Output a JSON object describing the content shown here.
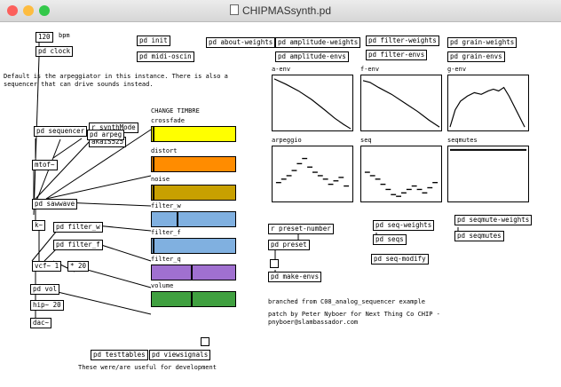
{
  "window": {
    "title": "CHIPMASsynth.pd",
    "traffic_light_colors": {
      "close": "#fc605c",
      "minimize": "#fdbc40",
      "zoom": "#34c84a"
    }
  },
  "objects": {
    "bpm_value": "120",
    "bpm_label": "bpm",
    "pd_clock": "pd clock",
    "pd_init": "pd init",
    "pd_midi_oscin": "pd midi-oscin",
    "pd_about_weights": "pd about-weights",
    "pd_amplitude_weights": "pd amplitude-weights",
    "pd_amplitude_envs": "pd amplitude-envs",
    "pd_filter_weights": "pd filter-weights",
    "pd_filter_envs": "pd filter-envs",
    "pd_grain_weights": "pd grain-weights",
    "pd_grain_envs": "pd grain-envs",
    "r_synthmode": "r synthMode",
    "akai_s525": "akaiS525",
    "pd_sequencer": "pd sequencer",
    "pd_arpeg": "pd arpeg",
    "mtof": "mtof~",
    "pd_sawwave": "pd sawwave",
    "k_obj": "k~",
    "pd_filter_w": "pd filter_w",
    "pd_filter_f": "pd filter_f",
    "vcf": "vcf~ 1",
    "mult_20": "* 20",
    "pd_vol": "pd vol",
    "hip": "hip~ 20",
    "dac": "dac~",
    "pd_testtables": "pd testtables",
    "pd_viewsignals": "pd viewsignals",
    "r_preset_number": "r preset-number",
    "pd_preset": "pd preset",
    "pd_make_envs": "pd make-envs",
    "pd_seq_weights": "pd seq-weights",
    "pd_seqs": "pd seqs",
    "pd_seq_modify": "pd seq-modify",
    "pd_seqmute_weights": "pd seqmute-weights",
    "pd_seqmutes": "pd seqmutes"
  },
  "comments": {
    "default_line1": "Default is the arpeggiator in this instance. There is also a",
    "default_line2": "sequencer that can drive sounds instead.",
    "change_timbre": "CHANGE TIMBRE",
    "branched": "branched from C08_analog_sequencer example",
    "patch_by_1": "patch by Peter Nyboer for Next Thing Co CHIP -",
    "patch_by_2": "pnyboer@slambassador.com",
    "useful": "These were/are useful for development"
  },
  "sliders": [
    {
      "label": "crossfade",
      "color": "#ffff00",
      "level": 0.01
    },
    {
      "label": "distort",
      "color": "#ff8c00",
      "level": 0.01
    },
    {
      "label": "noise",
      "color": "#c8a000",
      "level": 0.01
    },
    {
      "label": "filter_w",
      "color": "#80b0e0",
      "level": 0.3
    },
    {
      "label": "filter_f",
      "color": "#80b0e0",
      "level": 0.01
    },
    {
      "label": "filter_q",
      "color": "#a070d0",
      "level": 0.48
    },
    {
      "label": "volume",
      "color": "#40a040",
      "level": 0.48
    }
  ],
  "arrays": {
    "a_env": "a-env",
    "f_env": "f-env",
    "g_env": "g-env",
    "arpeggio": "arpeggio",
    "seq": "seq",
    "seqmutes": "seqmutes"
  }
}
